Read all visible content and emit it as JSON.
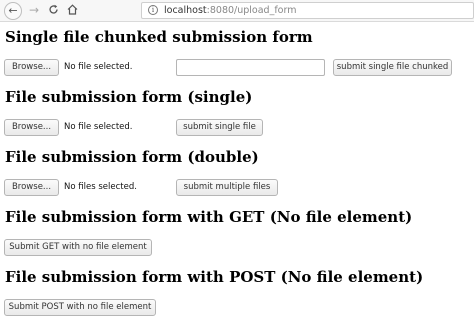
{
  "browser": {
    "url_host": "localhost",
    "url_rest": ":8080/upload_form",
    "back_glyph": "←",
    "forward_glyph": "→",
    "reload_glyph": "C",
    "home_glyph": "⌂",
    "info_glyph": "i"
  },
  "sections": {
    "chunked": {
      "heading": "Single file chunked submission form",
      "browse_label": "Browse...",
      "status": "No file selected.",
      "text_value": "",
      "submit_label": "submit single file chunked"
    },
    "single": {
      "heading": "File submission form (single)",
      "browse_label": "Browse...",
      "status": "No file selected.",
      "submit_label": "submit single file"
    },
    "double": {
      "heading": "File submission form (double)",
      "browse_label": "Browse...",
      "status": "No files selected.",
      "submit_label": "submit multiple files"
    },
    "get": {
      "heading": "File submission form with GET (No file element)",
      "submit_label": "Submit GET with no file element"
    },
    "post": {
      "heading": "File submission form with POST (No file element)",
      "submit_label": "Submit POST with no file element"
    }
  }
}
